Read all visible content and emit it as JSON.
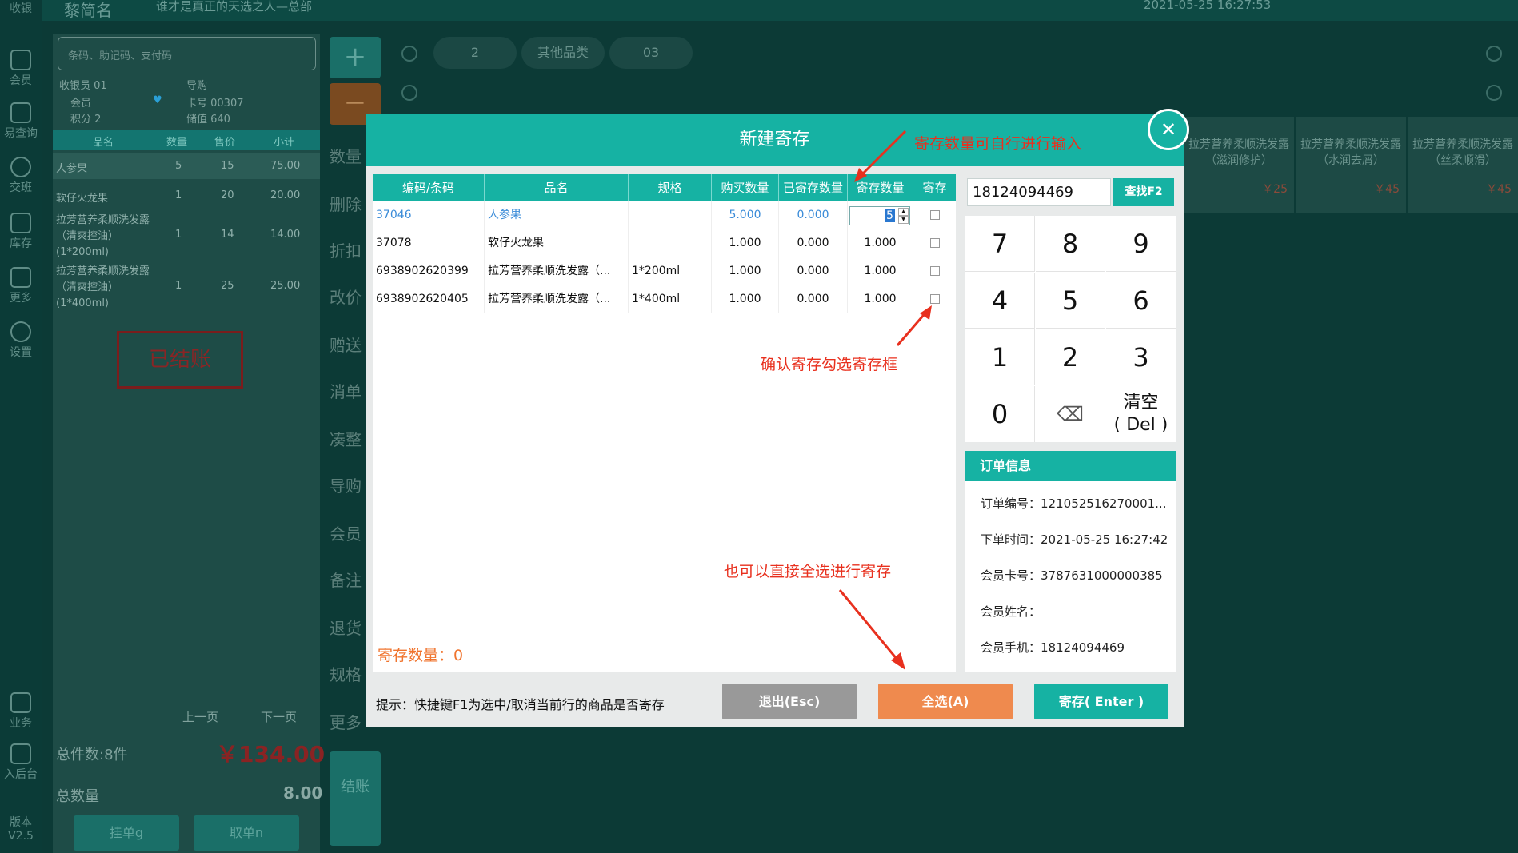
{
  "topbar": {
    "brand": "黎简名",
    "slogan": "谁才是真正的天选之人—总部",
    "datetime": "2021-05-25 16:27:53"
  },
  "sidebar": {
    "items": [
      {
        "label": "收银",
        "icon": "monitor-icon"
      },
      {
        "label": "会员",
        "icon": "user-icon"
      },
      {
        "label": "易查询",
        "icon": "document-icon"
      },
      {
        "label": "交班",
        "icon": "swap-icon"
      },
      {
        "label": "库存",
        "icon": "house-icon"
      },
      {
        "label": "更多",
        "icon": "grid-icon"
      },
      {
        "label": "设置",
        "icon": "gear-icon"
      },
      {
        "label": "业务",
        "icon": "briefcase-icon"
      },
      {
        "label": "入后台",
        "icon": "monitor-icon"
      },
      {
        "label": "版本",
        "icon": ""
      },
      {
        "label": "V2.5",
        "icon": ""
      }
    ]
  },
  "left": {
    "search_placeholder": "条码、助记码、支付码",
    "cashier": "收银员 01",
    "guide": "导购",
    "member": "会员",
    "card": "卡号 00307",
    "points": "积分 2",
    "stored": "储值 640",
    "headers": [
      "品名",
      "数量",
      "售价",
      "小计"
    ],
    "rows": [
      {
        "name": "人参果",
        "qty": "5",
        "price": "15",
        "total": "75.00"
      },
      {
        "name": "软仔火龙果",
        "qty": "1",
        "price": "20",
        "total": "20.00"
      },
      {
        "name": "拉芳营养柔顺洗发露（清爽控油）(1*200ml)",
        "qty": "1",
        "price": "14",
        "total": "14.00"
      },
      {
        "name": "拉芳营养柔顺洗发露（清爽控油）(1*400ml)",
        "qty": "1",
        "price": "25",
        "total": "25.00"
      }
    ],
    "paid_stamp": "已结账",
    "prev": "上一页",
    "next": "下一页",
    "total_items": "总件数:8件",
    "total_amount": "￥134.00",
    "total_qty_label": "总数量",
    "total_qty": "8.00",
    "hang": "挂单g",
    "take": "取单n"
  },
  "midbar": {
    "plus": "+",
    "minus": "−",
    "items": [
      "数量",
      "删除",
      "折扣",
      "改价",
      "赠送",
      "消单",
      "凑整",
      "导购",
      "会员",
      "备注",
      "退货",
      "规格",
      "更多"
    ],
    "checkout": "结账"
  },
  "categories": {
    "tabs": [
      "2",
      "其他品类",
      "03"
    ]
  },
  "products": [
    {
      "name": "拉芳营养柔顺洗发露（滋润修护）",
      "price": "￥25"
    },
    {
      "name": "拉芳营养柔顺洗发露（水润去屑）",
      "price": "￥45"
    },
    {
      "name": "拉芳营养柔顺洗发露（丝柔顺滑）",
      "price": "￥45"
    }
  ],
  "dialog": {
    "title": "新建寄存",
    "close": "✕",
    "headers": [
      "编码/条码",
      "品名",
      "规格",
      "购买数量",
      "已寄存数量",
      "寄存数量",
      "寄存"
    ],
    "rows": [
      {
        "code": "37046",
        "name": "人参果",
        "spec": "",
        "buy": "5.000",
        "stored": "0.000",
        "deposit": "5"
      },
      {
        "code": "37078",
        "name": "软仔火龙果",
        "spec": "",
        "buy": "1.000",
        "stored": "0.000",
        "deposit": "1.000"
      },
      {
        "code": "6938902620399",
        "name": "拉芳营养柔顺洗发露（...",
        "spec": "1*200ml",
        "buy": "1.000",
        "stored": "0.000",
        "deposit": "1.000"
      },
      {
        "code": "6938902620405",
        "name": "拉芳营养柔顺洗发露（...",
        "spec": "1*400ml",
        "buy": "1.000",
        "stored": "0.000",
        "deposit": "1.000"
      }
    ],
    "sum": "寄存数量：0",
    "hint": "提示：快捷键F1为选中/取消当前行的商品是否寄存",
    "exit": "退出(Esc)",
    "select_all": "全选(A)",
    "deposit_btn": "寄存( Enter )",
    "phone": "18124094469",
    "find": "查找F2",
    "keys": [
      "7",
      "8",
      "9",
      "4",
      "5",
      "6",
      "1",
      "2",
      "3",
      "0",
      "⌫",
      "清空\n( Del )"
    ],
    "order_title": "订单信息",
    "order": [
      {
        "label": "订单编号：",
        "value": "121052516270001..."
      },
      {
        "label": "下单时间：",
        "value": "2021-05-25 16:27:42"
      },
      {
        "label": "会员卡号：",
        "value": "3787631000000385"
      },
      {
        "label": "会员姓名：",
        "value": ""
      },
      {
        "label": "会员手机：",
        "value": "18124094469"
      }
    ]
  },
  "annotations": [
    "寄存数量可自行进行输入",
    "确认寄存勾选寄存框",
    "也可以直接全选进行寄存"
  ],
  "colors": {
    "accent": "#16b2a3",
    "orange": "#ef8a4e",
    "red": "#e8301e",
    "grey": "#999999"
  }
}
